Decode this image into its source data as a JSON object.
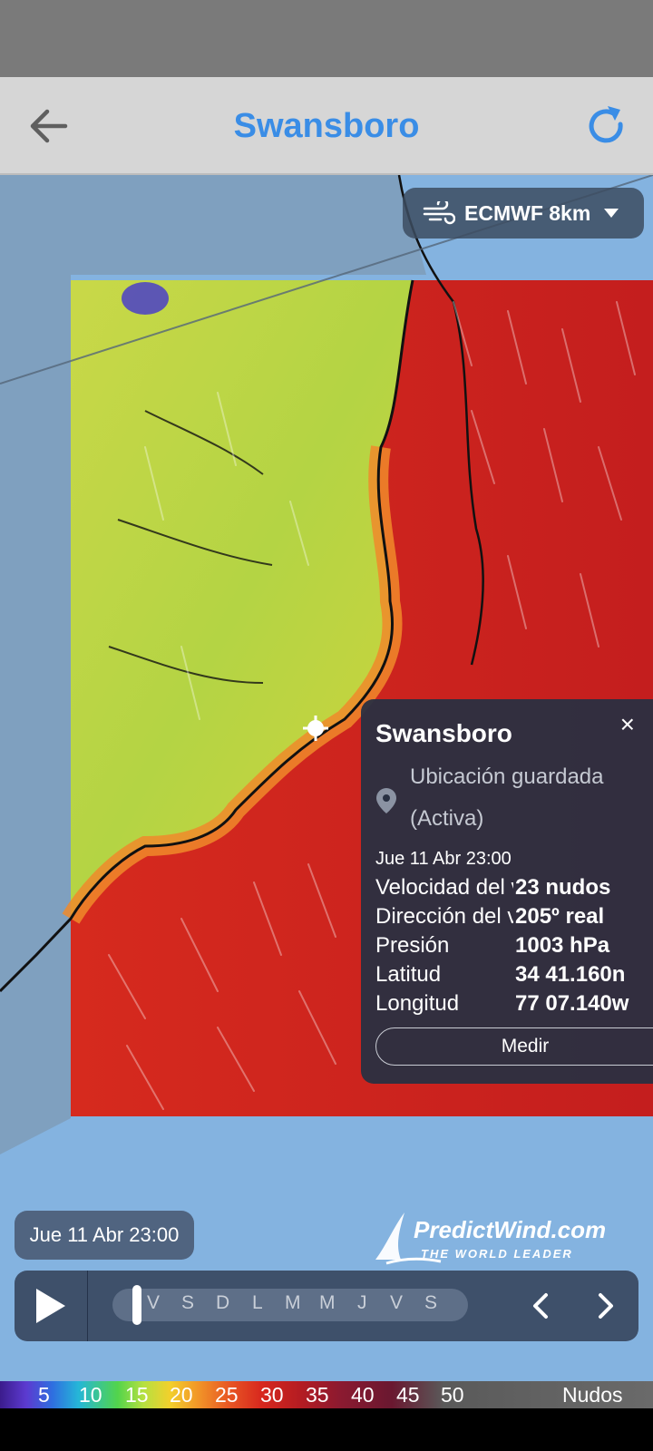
{
  "header": {
    "title": "Swansboro"
  },
  "map": {
    "model": "ECMWF 8km"
  },
  "popup": {
    "name": "Swansboro",
    "saved_line1": "Ubicación guardada",
    "saved_line2": "(Activa)",
    "datetime": "Jue 11 Abr 23:00",
    "rows": [
      {
        "label": "Velocidad del viento",
        "value": "23 nudos"
      },
      {
        "label": "Dirección del viento",
        "value": "205º real"
      },
      {
        "label": "Presión",
        "value": "1003 hPa"
      },
      {
        "label": "Latitud",
        "value": "34 41.160n"
      },
      {
        "label": "Longitud",
        "value": "77 07.140w"
      }
    ],
    "measure_label": "Medir",
    "close": "×"
  },
  "logo": {
    "line1": "PredictWind.com",
    "line2": "THE WORLD LEADER"
  },
  "timebar": {
    "current": "Jue 11 Abr 23:00",
    "days": [
      "V",
      "S",
      "D",
      "L",
      "M",
      "M",
      "J",
      "V",
      "S"
    ]
  },
  "legend": {
    "ticks": [
      "5",
      "10",
      "15",
      "20",
      "25",
      "30",
      "35",
      "40",
      "45",
      "50"
    ],
    "unit": "Nudos"
  },
  "colors": {
    "accent": "#3a8de6",
    "panel": "#283042",
    "wind_high": "#d8281e",
    "wind_low": "#b6d640"
  }
}
